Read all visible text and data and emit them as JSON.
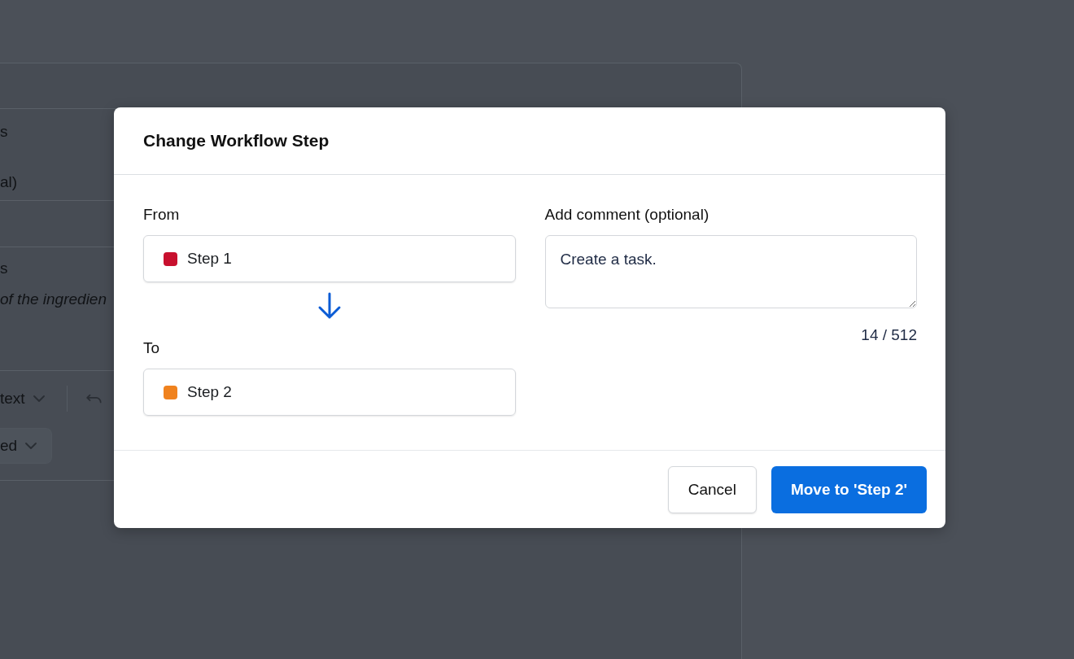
{
  "background": {
    "field_label_1": "s",
    "field_value_1": "al)",
    "field_label_2": "s",
    "field_hint": "of the ingredien",
    "text_style_menu": "text",
    "status_menu": "ed"
  },
  "dialog": {
    "title": "Change Workflow Step",
    "from": {
      "label": "From",
      "step": "Step 1",
      "color": "#c8102e"
    },
    "to": {
      "label": "To",
      "step": "Step 2",
      "color": "#f0821e"
    },
    "comment": {
      "label": "Add comment (optional)",
      "value": "Create a task.",
      "counter": "14 / 512"
    },
    "buttons": [
      {
        "label": "Cancel",
        "kind": "secondary"
      },
      {
        "label": "Move to 'Step 2'",
        "kind": "primary"
      }
    ]
  }
}
